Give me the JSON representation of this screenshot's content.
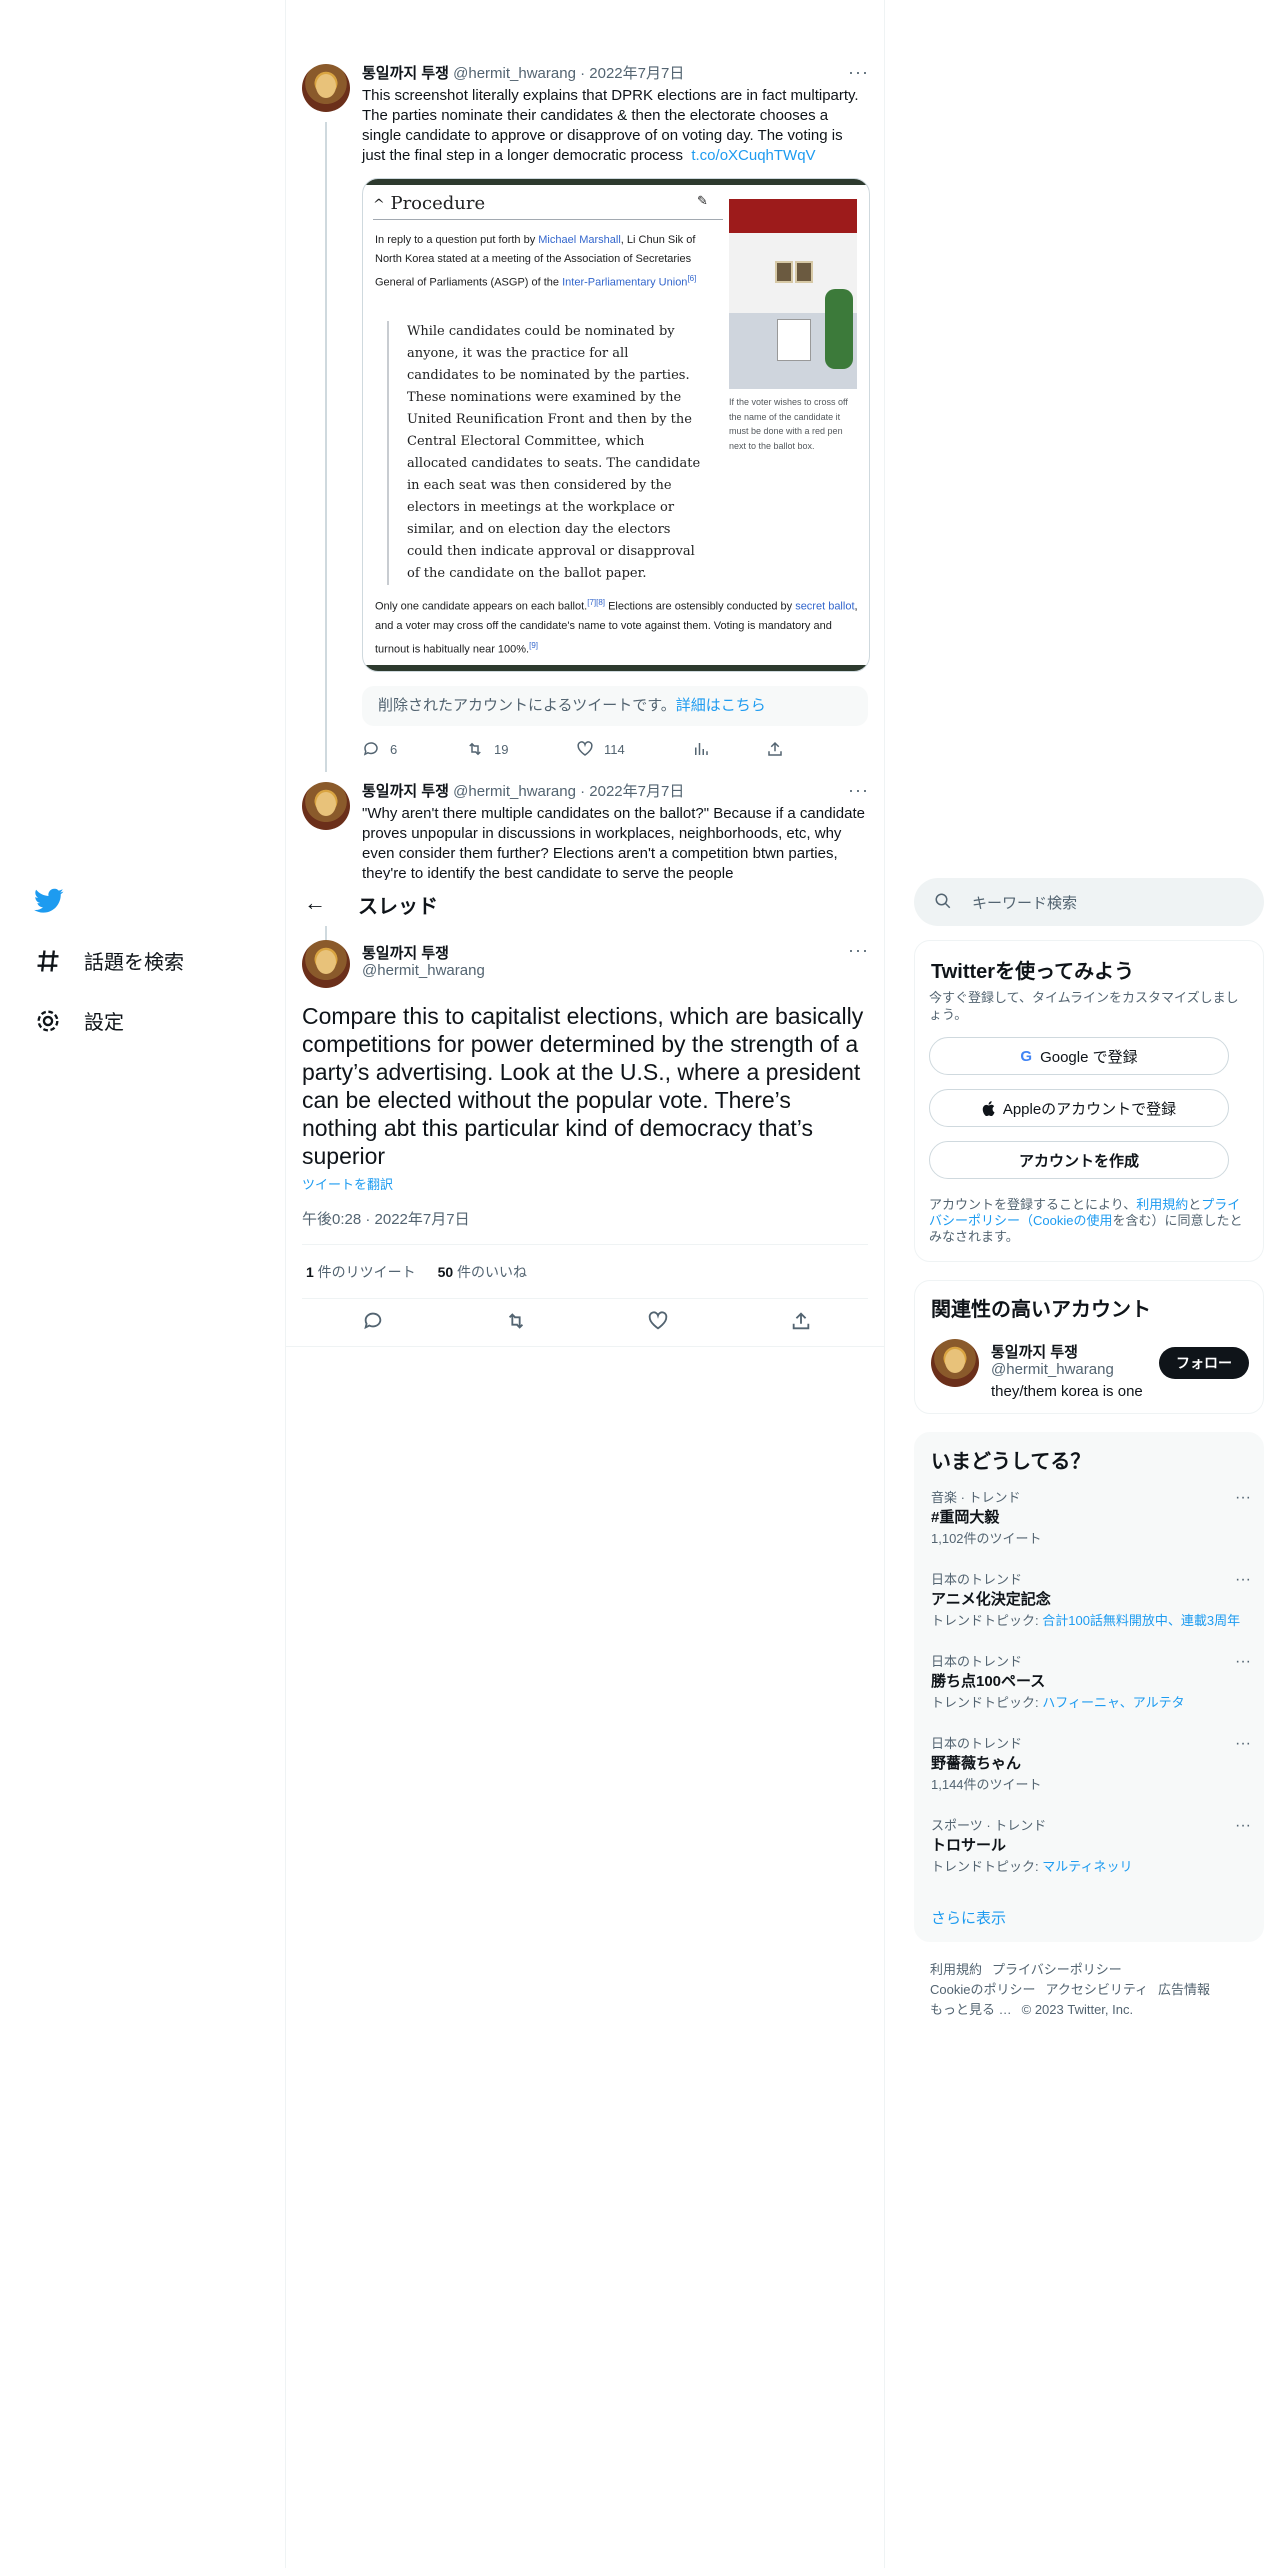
{
  "nav": {
    "explore_label": "話題を検索",
    "settings_label": "設定"
  },
  "tweets": [
    {
      "name": "통일까지 투쟁",
      "handle": "@hermit_hwarang",
      "date": "· 2022年7月7日",
      "text": "This screenshot literally explains that DPRK elections are in fact multiparty. The parties nominate their candidates & then the electorate chooses a single candidate to approve or disapprove of on voting day. The voting is just the final step in a longer democratic process",
      "link": "t.co/oXCuqhTWqV",
      "deleted_text": "削除されたアカウントによるツイートです。",
      "deleted_link": "詳細はこちら",
      "replies": "6",
      "retweets": "19",
      "likes": "114"
    },
    {
      "name": "통일까지 투쟁",
      "handle": "@hermit_hwarang",
      "date": "· 2022年7月7日",
      "text": "\"Why aren't there multiple candidates on the ballot?\" Because if a candidate proves unpopular in discussions in workplaces, neighborhoods, etc, why even consider them further? Elections aren't a competition btwn parties, they're to identify the best candidate to serve the people"
    }
  ],
  "wiki_card": {
    "heading": "Procedure",
    "intro_1": "In reply to a question put forth by ",
    "intro_link_1": "Michael Marshall",
    "intro_2": ", Li Chun Sik of North Korea stated at a meeting of the Association of Secretaries General of Parliaments (ASGP) of the ",
    "intro_link_2": "Inter-Parliamentary Union",
    "intro_ref": "[6]",
    "quote": "While candidates could be nominated by anyone, it was the practice for all candidates to be nominated by the parties. These nominations were examined by the United Reunification Front and then by the Central Electoral Committee, which allocated candidates to seats. The candidate in each seat was then considered by the electors in meetings at the workplace or similar, and on election day the electors could then indicate approval or disapproval of the candidate on the ballot paper.",
    "outro_1": "Only one candidate appears on each ballot.",
    "outro_ref_1": "[7][8]",
    "outro_2": " Elections are ostensibly conducted by ",
    "outro_link": "secret ballot",
    "outro_3": ", and a voter may cross off the candidate's name to vote against them. Voting is mandatory and turnout is habitually near 100%.",
    "outro_ref_2": "[9]",
    "caption": "If the voter wishes to cross off the name of the candidate it must be done with a red pen next to the ballot box."
  },
  "thread": {
    "title": "スレッド",
    "name": "통일까지 투쟁",
    "handle": "@hermit_hwarang",
    "text": "Compare this to capitalist elections, which are basically competitions for power determined by the strength of a party’s advertising. Look at the U.S., where a president can be elected without the popular vote. There’s nothing abt this particular kind of democracy that’s superior",
    "translate": "ツイートを翻訳",
    "timestamp": "午後0:28 · 2022年7月7日",
    "retweet_count": "1",
    "retweet_label": " 件のリツイート",
    "like_count": "50",
    "like_label": " 件のいいね"
  },
  "search": {
    "placeholder": "キーワード検索"
  },
  "signup": {
    "title": "Twitterを使ってみよう",
    "desc": "今すぐ登録して、タイムラインをカスタマイズしましょう。",
    "google_btn": "Google で登録",
    "apple_btn": "Appleのアカウントで登録",
    "create_btn": "アカウントを作成",
    "legal_1": "アカウントを登録することにより、",
    "legal_terms": "利用規約",
    "legal_2": "と",
    "legal_privacy": "プライバシーポリシー（Cookieの使用",
    "legal_3": "を含む）に同意したとみなされます。"
  },
  "related": {
    "title": "関連性の高いアカウント",
    "name": "통일까지 투쟁",
    "handle": "@hermit_hwarang",
    "bio": "they/them korea is one",
    "follow": "フォロー"
  },
  "trends": {
    "title": "いまどうしてる？",
    "items": [
      {
        "category": "音楽 · トレンド",
        "name": "#重岡大毅",
        "sub": "1,102件のツイート",
        "sub_link": ""
      },
      {
        "category": "日本のトレンド",
        "name": "アニメ化決定記念",
        "sub": "トレンドトピック: ",
        "sub_link": "合計100話無料開放中、連載3周年"
      },
      {
        "category": "日本のトレンド",
        "name": "勝ち点100ペース",
        "sub": "トレンドトピック: ",
        "sub_link": "ハフィーニャ、アルテタ"
      },
      {
        "category": "日本のトレンド",
        "name": "野薔薇ちゃん",
        "sub": "1,144件のツイート",
        "sub_link": ""
      },
      {
        "category": "スポーツ · トレンド",
        "name": "トロサール",
        "sub": "トレンドトピック: ",
        "sub_link": "マルティネッリ"
      }
    ],
    "show_more": "さらに表示"
  },
  "footer": {
    "terms": "利用規約",
    "privacy": "プライバシーポリシー",
    "cookie": "Cookieのポリシー",
    "accessibility": "アクセシビリティ",
    "ads": "広告情報",
    "more": "もっと見る …",
    "copyright": "© 2023 Twitter, Inc."
  },
  "colors": {
    "accent": "#1d9bf0",
    "text": "#0f1419",
    "muted": "#536471"
  }
}
